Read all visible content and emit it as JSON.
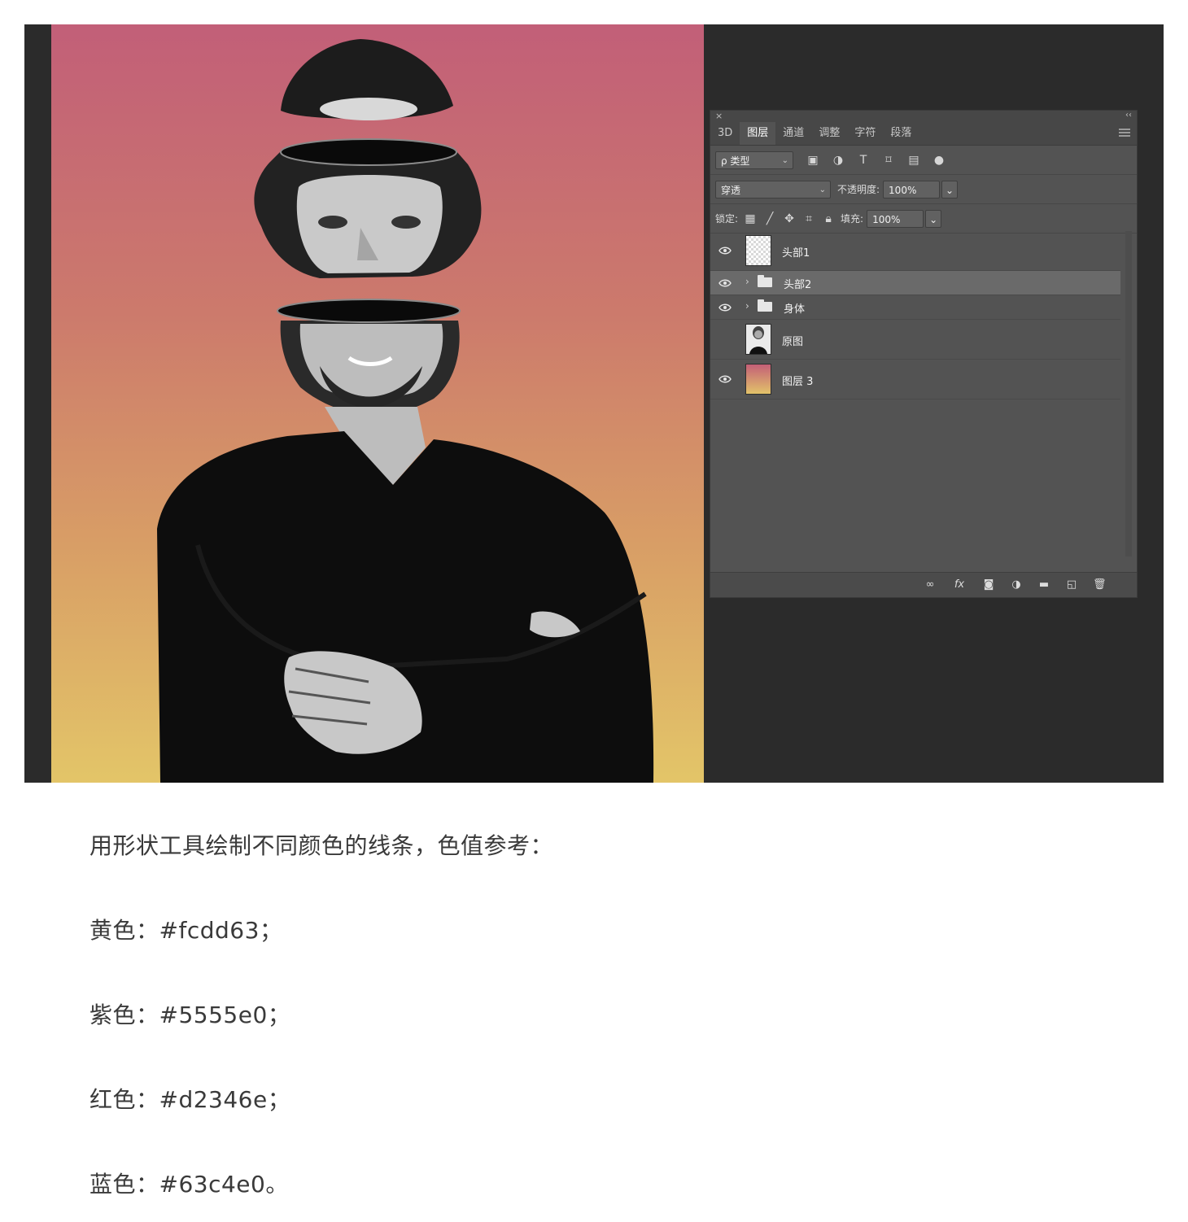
{
  "layers_panel": {
    "tabs": [
      "3D",
      "图层",
      "通道",
      "调整",
      "字符",
      "段落"
    ],
    "active_tab": "图层",
    "filter_kind": "ρ 类型",
    "blend_mode": "穿透",
    "opacity_label": "不透明度:",
    "opacity_value": "100%",
    "lock_label": "锁定:",
    "fill_label": "填充:",
    "fill_value": "100%",
    "layers": [
      {
        "name": "头部1",
        "type": "pixel",
        "visible": true
      },
      {
        "name": "头部2",
        "type": "group",
        "visible": true,
        "selected": true
      },
      {
        "name": "身体",
        "type": "group",
        "visible": true
      },
      {
        "name": "原图",
        "type": "pixel",
        "visible": false
      },
      {
        "name": "图层 3",
        "type": "gradient",
        "visible": true
      }
    ],
    "bottom_icons": [
      "link-icon",
      "fx-icon",
      "mask-icon",
      "adjustment-icon",
      "new-group-icon",
      "new-layer-icon",
      "trash-icon"
    ]
  },
  "article": {
    "intro": "用形状工具绘制不同颜色的线条，色值参考：",
    "colors": [
      {
        "text": "黄色：#fcdd63；",
        "hex": "#fcdd63"
      },
      {
        "text": "紫色：#5555e0；",
        "hex": "#5555e0"
      },
      {
        "text": "红色：#d2346e；",
        "hex": "#d2346e"
      },
      {
        "text": "蓝色：#63c4e0。",
        "hex": "#63c4e0"
      }
    ]
  },
  "canvas": {
    "background_gradient": [
      "#c25f78",
      "#e3c568"
    ]
  }
}
